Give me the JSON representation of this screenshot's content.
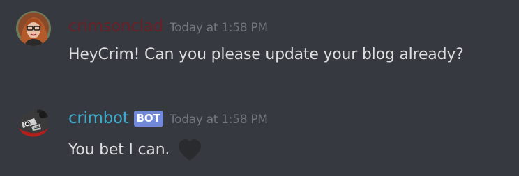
{
  "colors": {
    "background": "#36393f",
    "message_text": "#dcddde",
    "timestamp": "#72767d",
    "bot_tag_bg": "#7289da"
  },
  "messages": [
    {
      "username": "crimsonclad",
      "username_color": "#6b1f26",
      "timestamp": "Today at 1:58 PM",
      "text": "HeyCrim! Can you please update your blog already?"
    },
    {
      "username": "crimbot",
      "username_color": "#3fa9c9",
      "bot_tag": "BOT",
      "timestamp": "Today at 1:58 PM",
      "text": "You bet I can.",
      "reaction_icon": "black-heart-icon"
    }
  ]
}
